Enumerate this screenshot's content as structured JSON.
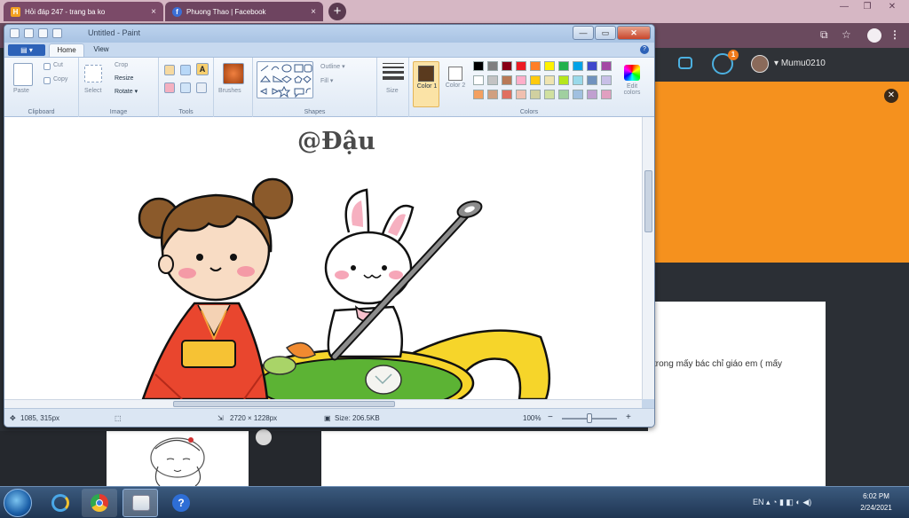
{
  "browser": {
    "tabs": [
      {
        "label": "Hỏi đáp 247 - trang ba ko",
        "favicon": "H"
      },
      {
        "label": "Phuong Thao | Facebook",
        "favicon": "f"
      }
    ],
    "new_tab": "+",
    "tab_close": "×",
    "window_controls": {
      "minimize": "—",
      "restore": "❐",
      "close": "✕"
    },
    "toolbar_icons": {
      "translate": "⧉",
      "bookmark": "☆",
      "menu": "⋮"
    }
  },
  "site": {
    "notification_count": "1",
    "username": "Mumu0210",
    "dropdown_glyph": "▾",
    "banner_close": "✕",
    "content_text": "trong mấy bác chỉ giáo em ( mấy"
  },
  "paint": {
    "title": "Untitled - Paint",
    "file_tab": "▤ ▾",
    "tabs": {
      "home": "Home",
      "view": "View"
    },
    "help": "?",
    "window_controls": {
      "minimize": "—",
      "maximize": "▭",
      "close": "✕"
    },
    "ribbon": {
      "clipboard": {
        "paste": "Paste",
        "cut": "Cut",
        "copy": "Copy",
        "label": "Clipboard"
      },
      "image": {
        "select": "Select",
        "crop": "Crop",
        "resize": "Resize",
        "rotate": "Rotate ▾",
        "label": "Image"
      },
      "tools": {
        "label": "Tools"
      },
      "brushes": {
        "label": "Brushes"
      },
      "shapes": {
        "outline": "Outline ▾",
        "fill": "Fill ▾",
        "label": "Shapes"
      },
      "size": {
        "label": "Size"
      },
      "colors": {
        "color1": "Color 1",
        "color2": "Color 2",
        "edit": "Edit colors",
        "label": "Colors",
        "color1_value": "#5a3a1e",
        "color2_value": "#ffffff",
        "palette": [
          "#000000",
          "#7f7f7f",
          "#880015",
          "#ed1c24",
          "#ff7f27",
          "#fff200",
          "#22b14c",
          "#00a2e8",
          "#3f48cc",
          "#a349a4",
          "#ffffff",
          "#c3c3c3",
          "#b97a57",
          "#ffaec9",
          "#ffc90e",
          "#efe4b0",
          "#b5e61d",
          "#99d9ea",
          "#7092be",
          "#c8bfe7",
          "#f3a060",
          "#d0a080",
          "#e07060",
          "#f0c0b0",
          "#d0d0a0",
          "#d0e0a0",
          "#a0d0a0",
          "#a0c0e0",
          "#c0a0d0",
          "#e0a0c0"
        ]
      }
    },
    "canvas_title": "@Đậu",
    "status": {
      "cursor": "1085, 315px",
      "dimensions": "2720 × 1228px",
      "size": "Size: 206.5KB",
      "zoom": "100%",
      "zoom_out": "−",
      "zoom_in": "+"
    }
  },
  "taskbar": {
    "clock_time": "6:02 PM",
    "clock_date": "2/24/2021",
    "tray": "EN  ▴  ◔  ▮  ◧  ◐  ◀)"
  }
}
